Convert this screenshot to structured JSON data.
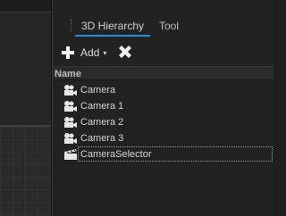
{
  "panel": {
    "tabs": [
      {
        "label": "3D Hierarchy",
        "active": true
      },
      {
        "label": "Tool",
        "active": false
      }
    ],
    "toolbar": {
      "add_label": "Add",
      "add_caret": "▾"
    },
    "column_header": "Name",
    "tree": [
      {
        "label": "Camera",
        "icon": "camera-icon"
      },
      {
        "label": "Camera 1",
        "icon": "camera-icon"
      },
      {
        "label": "Camera 2",
        "icon": "camera-icon"
      },
      {
        "label": "Camera 3",
        "icon": "camera-icon"
      },
      {
        "label": "CameraSelector",
        "icon": "clapperboard-icon",
        "selected": true
      }
    ]
  },
  "colors": {
    "accent": "#1e8fe0",
    "background": "#222222"
  }
}
